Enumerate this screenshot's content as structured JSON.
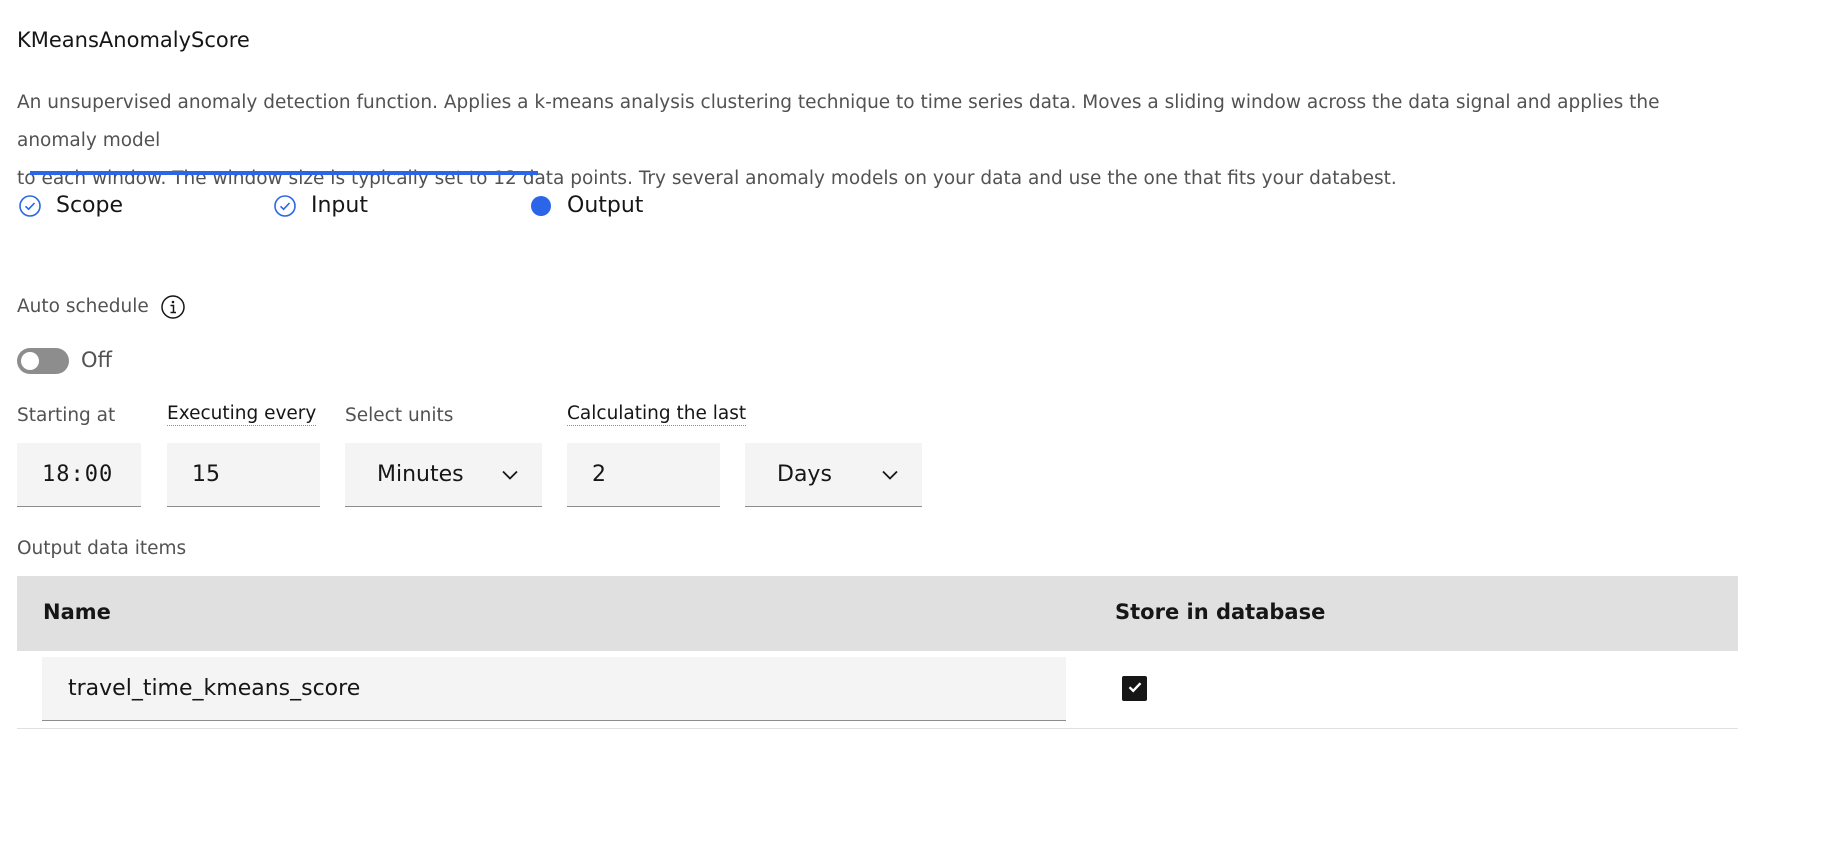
{
  "header": {
    "title": "KMeansAnomalyScore",
    "description_line1": "An unsupervised anomaly detection function. Applies a k-means analysis clustering technique to time series data. Moves a sliding window across the data signal and applies the anomaly model",
    "description_line2": "to each window. The window size is typically set to 12 data points. Try several anomaly models on your data and use the one that fits your databest."
  },
  "steps": [
    {
      "label": "Scope",
      "status": "complete",
      "icon": "checkmark-circle-icon"
    },
    {
      "label": "Input",
      "status": "complete",
      "icon": "checkmark-circle-icon"
    },
    {
      "label": "Output",
      "status": "current",
      "icon": "filled-circle-icon"
    }
  ],
  "schedule": {
    "auto_schedule_label": "Auto schedule",
    "info_icon": "info-icon",
    "toggle_state": "Off",
    "starting_at_label": "Starting at",
    "starting_at_value": "18:00",
    "executing_every_label": "Executing every",
    "executing_every_value": "15",
    "select_units_label": "Select units",
    "executing_units_value": "Minutes",
    "calculating_last_label": "Calculating the last",
    "calculating_last_value": "2",
    "calculating_units_value": "Days"
  },
  "output": {
    "section_label": "Output data items",
    "columns": [
      "Name",
      "Store in database"
    ],
    "rows": [
      {
        "name": "travel_time_kmeans_score",
        "store_in_database": true
      }
    ]
  },
  "colors": {
    "accent": "#2b65e8",
    "field_bg": "#f4f4f4",
    "table_header_bg": "#e0e0e0",
    "toggle_off": "#8d8d8d"
  }
}
